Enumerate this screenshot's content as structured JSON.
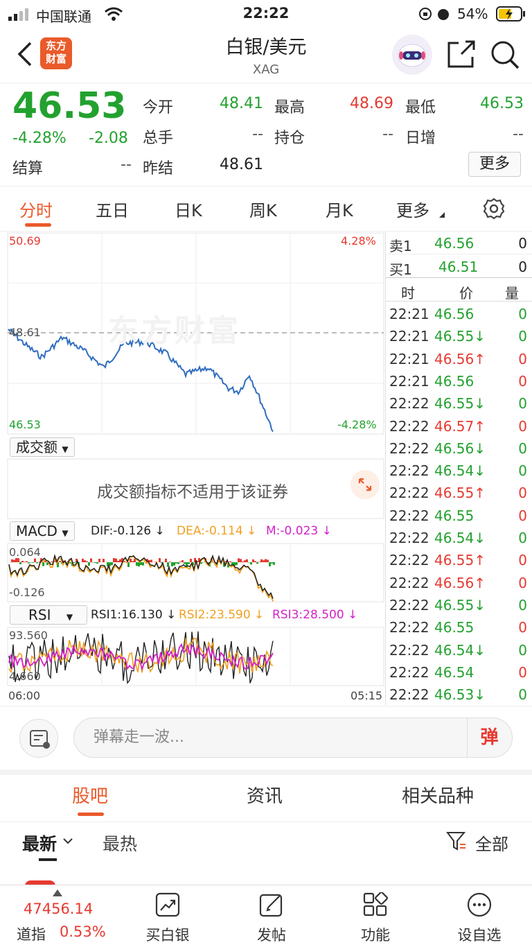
{
  "status": {
    "carrier": "中国联通",
    "time": "22:22",
    "battery": "54%"
  },
  "header": {
    "title": "白银/美元",
    "subtitle": "XAG",
    "logo": "东方\n财富"
  },
  "quote": {
    "price": "46.53",
    "change_pct": "-4.28%",
    "change": "-2.08",
    "open_label": "今开",
    "open": "48.41",
    "high_label": "最高",
    "high": "48.69",
    "low_label": "最低",
    "low": "46.53",
    "volume_label": "总手",
    "volume": "--",
    "oi_label": "持仓",
    "oi": "--",
    "daily_inc_label": "日增",
    "daily_inc": "--",
    "settle_label": "结算",
    "settle": "--",
    "prev_settle_label": "昨结",
    "prev_settle": "48.61",
    "more_label": "更多"
  },
  "tabs": [
    "分时",
    "五日",
    "日K",
    "周K",
    "月K",
    "更多"
  ],
  "chart": {
    "top_left": "50.69",
    "top_right": "4.28%",
    "ref": "48.61",
    "bottom_left": "46.53",
    "bottom_right": "-4.28%",
    "watermark": "东方财富",
    "volume_select": "成交额",
    "volume_note": "成交额指标不适用于该证券",
    "macd_select": "MACD",
    "dif": "DIF:-0.126 ↓",
    "dea": "DEA:-0.114 ↓",
    "m": "M:-0.023 ↓",
    "macd_top": "0.064",
    "macd_bottom": "-0.126",
    "rsi_select": "RSI",
    "rsi1": "RSI1:16.130 ↓",
    "rsi2": "RSI2:23.590 ↓",
    "rsi3": "RSI3:28.500 ↓",
    "rsi_top": "93.560",
    "rsi_bottom": "4.660",
    "x_start": "06:00",
    "x_end": "05:15"
  },
  "orderbook": {
    "sell_label": "卖1",
    "sell_price": "46.56",
    "sell_vol": "0",
    "buy_label": "买1",
    "buy_price": "46.51",
    "buy_vol": "0",
    "col_time": "时",
    "col_price": "价",
    "col_vol": "量"
  },
  "trades": [
    {
      "t": "22:21",
      "p": "46.56",
      "v": "0",
      "vc": "green"
    },
    {
      "t": "22:21",
      "p": "46.55↓",
      "v": "0",
      "vc": "green"
    },
    {
      "t": "22:21",
      "p": "46.56↑",
      "v": "0",
      "vc": "red"
    },
    {
      "t": "22:21",
      "p": "46.56",
      "v": "0",
      "vc": "red"
    },
    {
      "t": "22:22",
      "p": "46.55↓",
      "v": "0",
      "vc": "green"
    },
    {
      "t": "22:22",
      "p": "46.57↑",
      "v": "0",
      "vc": "red"
    },
    {
      "t": "22:22",
      "p": "46.56↓",
      "v": "0",
      "vc": "green"
    },
    {
      "t": "22:22",
      "p": "46.54↓",
      "v": "0",
      "vc": "green"
    },
    {
      "t": "22:22",
      "p": "46.55↑",
      "v": "0",
      "vc": "red"
    },
    {
      "t": "22:22",
      "p": "46.55",
      "v": "0",
      "vc": "red"
    },
    {
      "t": "22:22",
      "p": "46.54↓",
      "v": "0",
      "vc": "green"
    },
    {
      "t": "22:22",
      "p": "46.55↑",
      "v": "0",
      "vc": "red"
    },
    {
      "t": "22:22",
      "p": "46.56↑",
      "v": "0",
      "vc": "red"
    },
    {
      "t": "22:22",
      "p": "46.55↓",
      "v": "0",
      "vc": "green"
    },
    {
      "t": "22:22",
      "p": "46.55",
      "v": "0",
      "vc": "red"
    },
    {
      "t": "22:22",
      "p": "46.54↓",
      "v": "0",
      "vc": "green"
    },
    {
      "t": "22:22",
      "p": "46.54",
      "v": "0",
      "vc": "red"
    },
    {
      "t": "22:22",
      "p": "46.53↓",
      "v": "0",
      "vc": "green"
    }
  ],
  "danmu": {
    "placeholder": "弹幕走一波...",
    "btn": "弹"
  },
  "sections": [
    "股吧",
    "资讯",
    "相关品种"
  ],
  "filter": {
    "latest": "最新",
    "hot": "最热",
    "all": "全部"
  },
  "bottomnav": {
    "index_value": "47456.14",
    "index_name": "道指",
    "index_pct": "0.53%",
    "items": [
      "买白银",
      "发帖",
      "功能",
      "设自选"
    ]
  },
  "colors": {
    "accent": "#ea5a2a",
    "up": "#e53a31",
    "down": "#23a12f",
    "line": "#2f6dbf"
  }
}
